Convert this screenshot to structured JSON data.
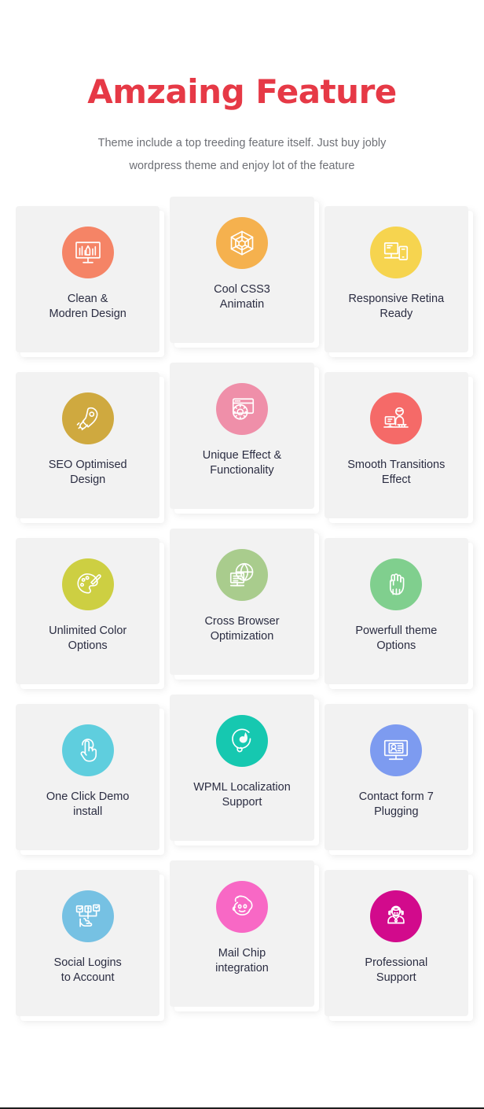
{
  "header": {
    "title": "Amzaing Feature",
    "subtitle": "Theme include a top treeding feature itself. Just buy jobly wordpress theme and enjoy lot of the feature",
    "title_color": "#e63946",
    "subtitle_color": "#6e7076"
  },
  "card_style": {
    "background": "#f2f2f2",
    "title_color": "#2b2d42"
  },
  "features": [
    {
      "title": "Clean &\nModren Design",
      "icon": "design-monitor-icon",
      "color": "#f58466",
      "column": 1,
      "row": 1
    },
    {
      "title": "Cool CSS3\nAnimatin",
      "icon": "cube-web-icon",
      "color": "#f5b14e",
      "column": 2,
      "row": 1
    },
    {
      "title": "Responsive Retina\nReady",
      "icon": "responsive-devices-icon",
      "color": "#f6d44f",
      "column": 3,
      "row": 1
    },
    {
      "title": "SEO Optimised\nDesign",
      "icon": "rocket-icon",
      "color": "#cfa93f",
      "column": 1,
      "row": 2
    },
    {
      "title": "Unique Effect &\nFunctionality",
      "icon": "browser-gear-icon",
      "color": "#ef8fa9",
      "column": 2,
      "row": 2
    },
    {
      "title": "Smooth Transitions\nEffect",
      "icon": "person-desk-icon",
      "color": "#f56a68",
      "column": 3,
      "row": 2
    },
    {
      "title": "Unlimited Color\nOptions",
      "icon": "palette-brush-icon",
      "color": "#cdcf42",
      "column": 1,
      "row": 3
    },
    {
      "title": "Cross Browser\nOptimization",
      "icon": "globe-browser-icon",
      "color": "#a9cc8d",
      "column": 2,
      "row": 3
    },
    {
      "title": "Powerfull theme\nOptions",
      "icon": "fist-icon",
      "color": "#80cf8e",
      "column": 3,
      "row": 3
    },
    {
      "title": "One Click Demo\ninstall",
      "icon": "tap-hand-icon",
      "color": "#5fcede",
      "column": 1,
      "row": 4
    },
    {
      "title": "WPML Localization\nSupport",
      "icon": "wpml-drop-icon",
      "color": "#16c8b0",
      "column": 2,
      "row": 4
    },
    {
      "title": "Contact form 7\nPlugging",
      "icon": "contact-form-icon",
      "color": "#7d9bf0",
      "column": 3,
      "row": 4
    },
    {
      "title": "Social Logins\nto Account",
      "icon": "social-share-icon",
      "color": "#76c1e3",
      "column": 1,
      "row": 5
    },
    {
      "title": "Mail Chip\nintegration",
      "icon": "mailchimp-monkey-icon",
      "color": "#f868c5",
      "column": 2,
      "row": 5
    },
    {
      "title": "Professional\nSupport",
      "icon": "support-agent-icon",
      "color": "#d20a8c",
      "column": 3,
      "row": 5
    }
  ]
}
